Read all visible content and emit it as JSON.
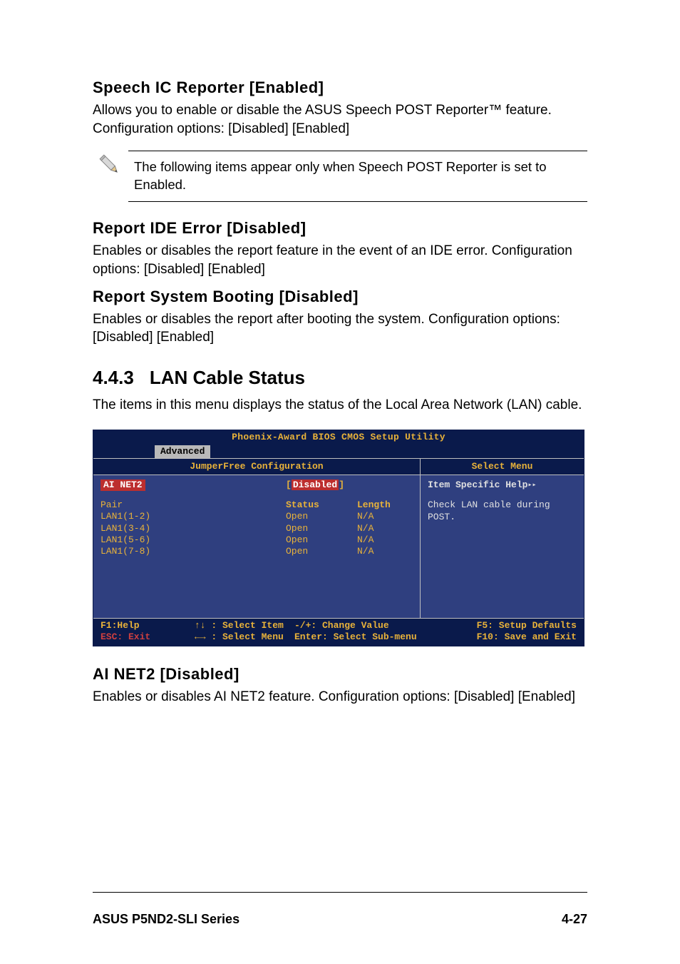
{
  "doc": {
    "s1": {
      "title": "Speech IC Reporter [Enabled]",
      "p": "Allows you to enable or disable  the ASUS Speech POST Reporter™ feature. Configuration options: [Disabled] [Enabled]"
    },
    "note": "The following items appear only when Speech POST Reporter is set to Enabled.",
    "s2": {
      "title": "Report IDE Error [Disabled]",
      "p": "Enables or disables the report feature in the event of an IDE error. Configuration options: [Disabled] [Enabled]"
    },
    "s3": {
      "title": "Report System Booting [Disabled]",
      "p": "Enables or disables the report after booting the system. Configuration options: [Disabled] [Enabled]"
    },
    "h2num": "4.4.3",
    "h2title": "LAN Cable Status",
    "h2p": "The items in this menu displays the status of the Local Area Network (LAN) cable.",
    "s4": {
      "title": "AI NET2 [Disabled]",
      "p": "Enables or disables AI NET2 feature. Configuration options: [Disabled] [Enabled]"
    }
  },
  "bios": {
    "title": "Phoenix-Award BIOS CMOS Setup Utility",
    "tab": "Advanced",
    "left_header": "JumperFree Configuration",
    "right_header": "Select Menu",
    "ai_net2_label": "AI NET2",
    "disabled_label": "Disabled",
    "help_header": "Item Specific Help",
    "help_text": "Check LAN cable during POST.",
    "cols": {
      "pair": "Pair",
      "status": "Status",
      "length": "Length"
    },
    "rows": [
      {
        "pair": "LAN1(1-2)",
        "status": "Open",
        "length": "N/A"
      },
      {
        "pair": "LAN1(3-4)",
        "status": "Open",
        "length": "N/A"
      },
      {
        "pair": "LAN1(5-6)",
        "status": "Open",
        "length": "N/A"
      },
      {
        "pair": "LAN1(7-8)",
        "status": "Open",
        "length": "N/A"
      }
    ],
    "footer": {
      "f1": "F1:Help",
      "arrows1": "↑↓   : Select Item",
      "change": "-/+: Change Value",
      "f5": "F5: Setup Defaults",
      "esc": "ESC: Exit",
      "arrows2": "←→   : Select Menu",
      "enter": "Enter: Select Sub-menu",
      "f10": "F10: Save and Exit"
    }
  },
  "footer": {
    "left": "ASUS P5ND2-SLI Series",
    "right": "4-27"
  }
}
